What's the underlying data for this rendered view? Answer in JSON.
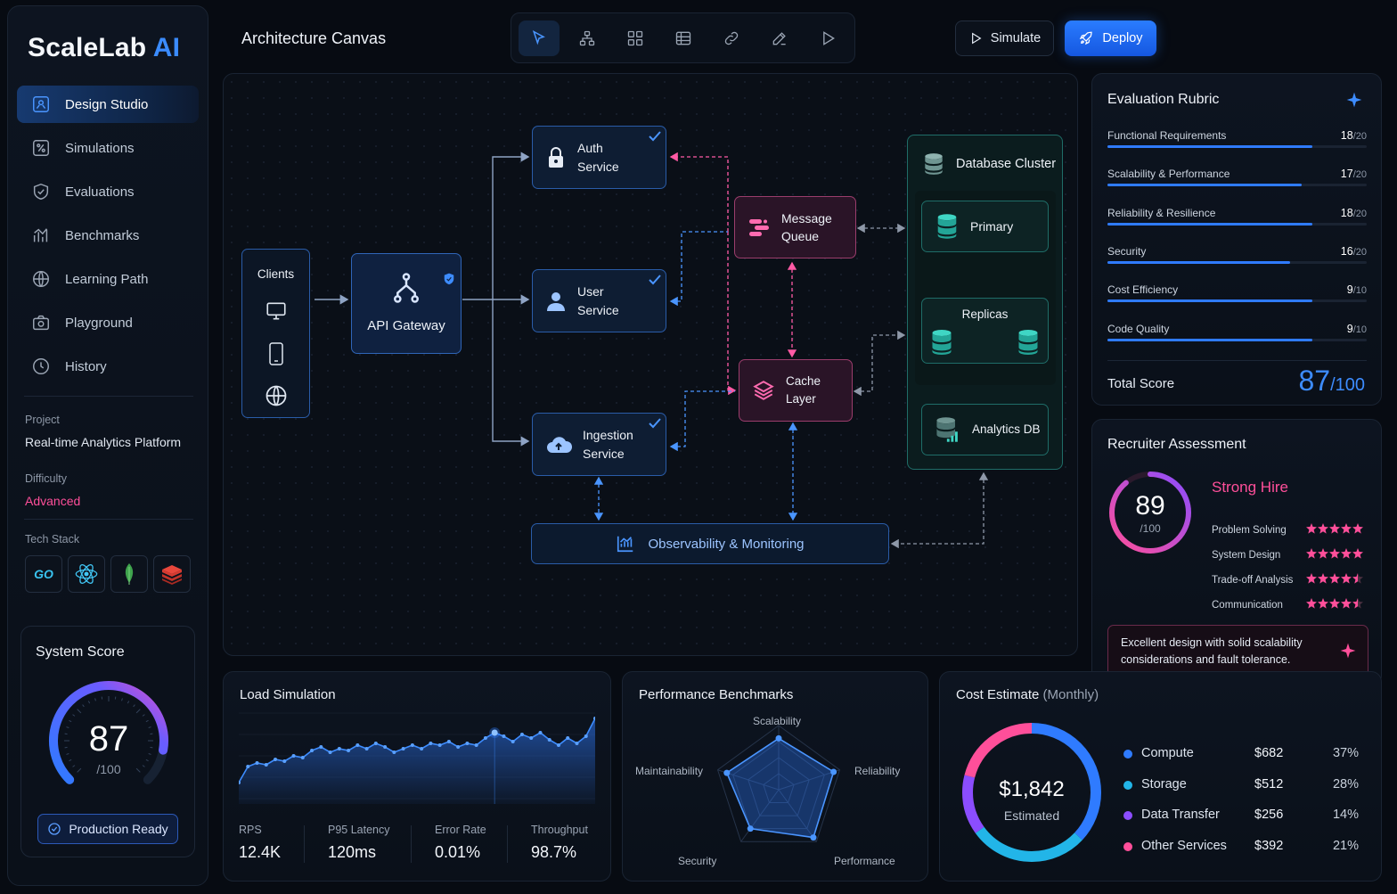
{
  "brand": {
    "name": "ScaleLab",
    "suffix": "AI",
    "accent": "#3b8cff"
  },
  "sidebar": {
    "items": [
      {
        "label": "Design Studio",
        "icon": "design-icon",
        "active": true
      },
      {
        "label": "Simulations",
        "icon": "simulation-icon"
      },
      {
        "label": "Evaluations",
        "icon": "shield-check-icon"
      },
      {
        "label": "Benchmarks",
        "icon": "benchmark-icon"
      },
      {
        "label": "Learning Path",
        "icon": "globe-icon"
      },
      {
        "label": "Playground",
        "icon": "camera-icon"
      },
      {
        "label": "History",
        "icon": "clock-icon"
      }
    ],
    "project_label": "Project",
    "project_value": "Real-time Analytics Platform",
    "difficulty_label": "Difficulty",
    "difficulty_value": "Advanced",
    "tech_label": "Tech Stack",
    "tech": [
      {
        "name": "GO",
        "icon": "go-icon"
      },
      {
        "name": "React",
        "icon": "react-icon"
      },
      {
        "name": "MongoDB",
        "icon": "leaf-icon"
      },
      {
        "name": "Redis",
        "icon": "redis-icon"
      }
    ],
    "system_score": {
      "title": "System Score",
      "value": "87",
      "max": "/100",
      "fraction": 0.87,
      "badge": "Production Ready"
    }
  },
  "header": {
    "title": "Architecture Canvas",
    "tools": [
      "pointer-icon",
      "hierarchy-icon",
      "components-icon",
      "list-icon",
      "link-icon",
      "edit-icon",
      "play-icon"
    ],
    "simulate_label": "Simulate",
    "deploy_label": "Deploy"
  },
  "canvas": {
    "clients": {
      "label": "Clients",
      "icons": [
        "desktop-icon",
        "mobile-icon",
        "globe-icon"
      ]
    },
    "gateway": "API Gateway",
    "auth": [
      "Auth",
      "Service"
    ],
    "user": [
      "User",
      "Service"
    ],
    "ingestion": [
      "Ingestion",
      "Service"
    ],
    "queue": [
      "Message",
      "Queue"
    ],
    "cache": "Cache Layer",
    "db_cluster": "Database Cluster",
    "primary": "Primary",
    "replicas": "Replicas",
    "analytics": "Analytics DB",
    "observability": "Observability & Monitoring"
  },
  "rubric": {
    "title": "Evaluation Rubric",
    "rows": [
      {
        "label": "Functional Requirements",
        "score": "18",
        "max": "/20",
        "fraction": 0.9
      },
      {
        "label": "Scalability & Performance",
        "score": "17",
        "max": "/20",
        "fraction": 0.85
      },
      {
        "label": "Reliability & Resilience",
        "score": "18",
        "max": "/20",
        "fraction": 0.9
      },
      {
        "label": "Security",
        "score": "16",
        "max": "/20",
        "fraction": 0.8
      },
      {
        "label": "Cost Efficiency",
        "score": "9",
        "max": "/10",
        "fraction": 0.9
      },
      {
        "label": "Code Quality",
        "score": "9",
        "max": "/10",
        "fraction": 0.9
      }
    ],
    "total_label": "Total Score",
    "total_value": "87",
    "total_max": "/100"
  },
  "recruiter": {
    "title": "Recruiter Assessment",
    "score": "89",
    "max": "/100",
    "fraction": 0.89,
    "verdict": "Strong Hire",
    "ratings": [
      {
        "label": "Problem Solving",
        "stars": 5
      },
      {
        "label": "System Design",
        "stars": 5
      },
      {
        "label": "Trade-off Analysis",
        "stars": 4.5
      },
      {
        "label": "Communication",
        "stars": 4.5
      }
    ],
    "comment": "Excellent design with solid scalability considerations and fault tolerance."
  },
  "load": {
    "title": "Load Simulation",
    "series": [
      20,
      38,
      42,
      40,
      46,
      44,
      50,
      48,
      56,
      60,
      54,
      58,
      56,
      62,
      58,
      64,
      60,
      54,
      58,
      62,
      58,
      64,
      62,
      66,
      60,
      64,
      62,
      70,
      76,
      72,
      66,
      74,
      70,
      76,
      68,
      62,
      70,
      64,
      72,
      92
    ],
    "highlight_index": 28,
    "metrics": [
      {
        "label": "RPS",
        "value": "12.4K"
      },
      {
        "label": "P95 Latency",
        "value": "120ms"
      },
      {
        "label": "Error Rate",
        "value": "0.01%"
      },
      {
        "label": "Throughput",
        "value": "98.7%"
      }
    ]
  },
  "performance": {
    "title": "Performance Benchmarks",
    "axes": [
      "Scalability",
      "Reliability",
      "Performance",
      "Security",
      "Maintainability"
    ],
    "values": [
      0.8,
      0.9,
      0.92,
      0.75,
      0.85
    ]
  },
  "cost": {
    "title": "Cost Estimate",
    "subtitle": "(Monthly)",
    "total": "$1,842",
    "total_label": "Estimated",
    "items": [
      {
        "name": "Compute",
        "amount": "$682",
        "pct": "37%",
        "value": 37,
        "color": "#2f7bff"
      },
      {
        "name": "Storage",
        "amount": "$512",
        "pct": "28%",
        "value": 28,
        "color": "#22b5e8"
      },
      {
        "name": "Data Transfer",
        "amount": "$256",
        "pct": "14%",
        "value": 14,
        "color": "#8b4dff"
      },
      {
        "name": "Other Services",
        "amount": "$392",
        "pct": "21%",
        "value": 21,
        "color": "#ff4f9a"
      }
    ]
  }
}
